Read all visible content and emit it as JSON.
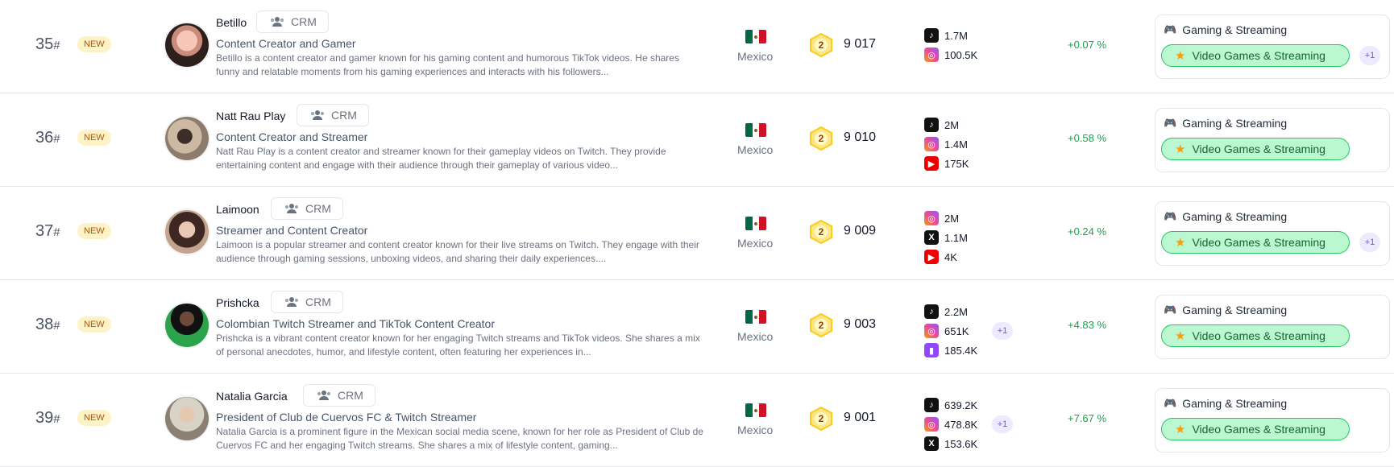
{
  "new_label": "NEW",
  "crm_label": "CRM",
  "colors": {
    "accent_green": "#16a34a",
    "tag_bg": "#bbf7d0",
    "badge_bg": "#fef3c7"
  },
  "rows": [
    {
      "rank": "35",
      "name": "Betillo",
      "title": "Content Creator and Gamer",
      "description": "Betillo is a content creator and gamer known for his gaming content and humorous TikTok videos. He shares funny and relatable moments from his gaming experiences and interacts with his followers...",
      "country": "Mexico",
      "level": "2",
      "score": "9 017",
      "socials": [
        {
          "icon": "tiktok-icon",
          "value": "1.7M"
        },
        {
          "icon": "instagram-icon",
          "value": "100.5K"
        }
      ],
      "socials_more": "",
      "change": "+0.07 %",
      "category": "Gaming & Streaming",
      "tag": "Video Games & Streaming",
      "tag_more": "+1"
    },
    {
      "rank": "36",
      "name": "Natt Rau Play",
      "title": "Content Creator and Streamer",
      "description": "Natt Rau Play is a content creator and streamer known for their gameplay videos on Twitch. They provide entertaining content and engage with their audience through their gameplay of various video...",
      "country": "Mexico",
      "level": "2",
      "score": "9 010",
      "socials": [
        {
          "icon": "tiktok-icon",
          "value": "2M"
        },
        {
          "icon": "instagram-icon",
          "value": "1.4M"
        },
        {
          "icon": "youtube-icon",
          "value": "175K"
        }
      ],
      "socials_more": "",
      "change": "+0.58 %",
      "category": "Gaming & Streaming",
      "tag": "Video Games & Streaming",
      "tag_more": ""
    },
    {
      "rank": "37",
      "name": "Laimoon",
      "title": "Streamer and Content Creator",
      "description": "Laimoon is a popular streamer and content creator known for their live streams on Twitch. They engage with their audience through gaming sessions, unboxing videos, and sharing their daily experiences....",
      "country": "Mexico",
      "level": "2",
      "score": "9 009",
      "socials": [
        {
          "icon": "instagram-icon",
          "value": "2M"
        },
        {
          "icon": "x-icon",
          "value": "1.1M"
        },
        {
          "icon": "youtube-icon",
          "value": "4K"
        }
      ],
      "socials_more": "",
      "change": "+0.24 %",
      "category": "Gaming & Streaming",
      "tag": "Video Games & Streaming",
      "tag_more": "+1"
    },
    {
      "rank": "38",
      "name": "Prishcka",
      "title": "Colombian Twitch Streamer and TikTok Content Creator",
      "description": "Prishcka is a vibrant content creator known for her engaging Twitch streams and TikTok videos. She shares a mix of personal anecdotes, humor, and lifestyle content, often featuring her experiences in...",
      "country": "Mexico",
      "level": "2",
      "score": "9 003",
      "socials": [
        {
          "icon": "tiktok-icon",
          "value": "2.2M"
        },
        {
          "icon": "instagram-icon",
          "value": "651K"
        },
        {
          "icon": "twitch-icon",
          "value": "185.4K"
        }
      ],
      "socials_more": "+1",
      "change": "+4.83 %",
      "category": "Gaming & Streaming",
      "tag": "Video Games & Streaming",
      "tag_more": ""
    },
    {
      "rank": "39",
      "name": "Natalia Garcia",
      "title": "President of Club de Cuervos FC & Twitch Streamer",
      "description": "Natalia Garcia is a prominent figure in the Mexican social media scene, known for her role as President of Club de Cuervos FC and her engaging Twitch streams. She shares a mix of lifestyle content, gaming...",
      "country": "Mexico",
      "level": "2",
      "score": "9 001",
      "socials": [
        {
          "icon": "tiktok-icon",
          "value": "639.2K"
        },
        {
          "icon": "instagram-icon",
          "value": "478.8K"
        },
        {
          "icon": "x-icon",
          "value": "153.6K"
        }
      ],
      "socials_more": "+1",
      "change": "+7.67 %",
      "category": "Gaming & Streaming",
      "tag": "Video Games & Streaming",
      "tag_more": ""
    }
  ]
}
